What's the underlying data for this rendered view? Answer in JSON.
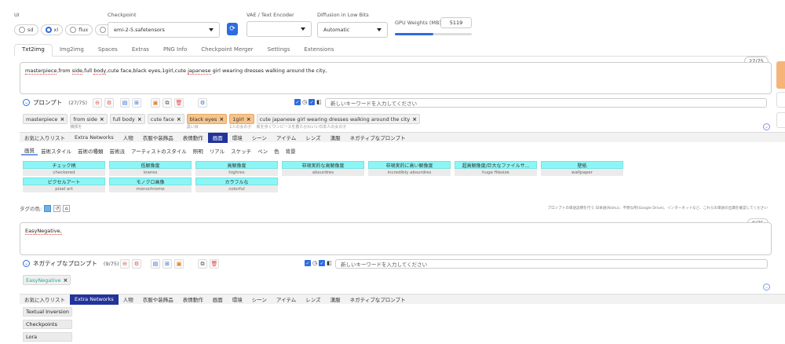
{
  "top": {
    "ui_label": "UI",
    "ui_options": [
      "sd",
      "xl",
      "flux",
      "all"
    ],
    "checkpoint_label": "Checkpoint",
    "checkpoint_value": "emi-2-5.safetensors",
    "vae_label": "VAE / Text Encoder",
    "vae_value": "",
    "diffusion_label": "Diffusion in Low Bits",
    "diffusion_value": "Automatic",
    "gpu_label": "GPU Weights (MB)",
    "gpu_value": "5119",
    "gpu_fraction": 0.5
  },
  "tabs": [
    "Txt2img",
    "Img2img",
    "Spaces",
    "Extras",
    "PNG Info",
    "Checkpoint Merger",
    "Settings",
    "Extensions"
  ],
  "prompt": {
    "counter": "27/75",
    "text_parts": [
      {
        "t": "masterpiece",
        "u": true
      },
      {
        "t": ",from ",
        "u": false
      },
      {
        "t": "side",
        "u": true
      },
      {
        "t": ",full ",
        "u": false
      },
      {
        "t": "body",
        "u": true
      },
      {
        "t": ",cute face,black eyes,1girl,cute ",
        "u": false
      },
      {
        "t": "japanese",
        "u": true
      },
      {
        "t": " girl wearing dresses walking around the city,",
        "u": false
      }
    ],
    "label": "プロンプト",
    "label_count": "(27/75)",
    "keyword_placeholder": "新しいキーワードを入力してください"
  },
  "prompt_tags": [
    {
      "text": "masterpiece",
      "sub": "",
      "style": "gray"
    },
    {
      "text": "from side",
      "sub": "横顔を",
      "style": "gray"
    },
    {
      "text": "full body",
      "sub": "",
      "style": "gray"
    },
    {
      "text": "cute face",
      "sub": "",
      "style": "gray"
    },
    {
      "text": "black eyes",
      "sub": "黒い目",
      "style": "orange"
    },
    {
      "text": "1girl",
      "sub": "1人の女の子",
      "style": "orange"
    },
    {
      "text": "cute japanese girl wearing dresses walking around the city",
      "sub": "街を歩くワンピースを着たかわいい日本人の女の子",
      "style": "gray"
    }
  ],
  "categories": [
    "お気に入りリスト",
    "Extra Networks",
    "人物",
    "衣服や装飾品",
    "表情動作",
    "画面",
    "環境",
    "シーン",
    "アイテム",
    "レンズ",
    "漢服",
    "ネガティブなプロンプト"
  ],
  "active_category": "画面",
  "subcategories": [
    "画質",
    "芸術スタイル",
    "芸術の種類",
    "芸術派",
    "アーティストのスタイル",
    "照明",
    "リアル",
    "スケッチ",
    "ペン",
    "色",
    "背景"
  ],
  "keywords": [
    {
      "jp": "チェック柄",
      "en": "checkered"
    },
    {
      "jp": "低解像度",
      "en": "lowres"
    },
    {
      "jp": "高解像度",
      "en": "highres"
    },
    {
      "jp": "非現実的な高解像度",
      "en": "absurdres"
    },
    {
      "jp": "非現実的に高い解像度",
      "en": "incredibly absurdres"
    },
    {
      "jp": "超高解像度/巨大なファイルサ...",
      "en": "huge filesize"
    },
    {
      "jp": "壁紙",
      "en": "wallpaper"
    },
    {
      "jp": "ピクセルアート",
      "en": "pixel art"
    },
    {
      "jp": "モノクロ画像",
      "en": "monochrome"
    },
    {
      "jp": "カラフルな",
      "en": "colorful"
    }
  ],
  "tag_color_label": "タグの色:",
  "footnote": "プロンプトの単語説明を行う 日本語(Nishu)、不明な所(Google Drive)、インターネットなど、これらの単語の出典を確認してください",
  "negative": {
    "counter": "9/75",
    "text": "EasyNegative,",
    "label": "ネガティブなプロンプト",
    "label_count": "(9/75)",
    "keyword_placeholder": "新しいキーワードを入力してください",
    "tag": "EasyNegative"
  },
  "negative_categories": [
    "お気に入りリスト",
    "Extra Networks",
    "人物",
    "衣服や装飾品",
    "表情動作",
    "画面",
    "環境",
    "シーン",
    "アイテム",
    "レンズ",
    "漢服",
    "ネガティブなプロンプト"
  ],
  "negative_active_category": "Extra Networks",
  "network_list": [
    "Textual Inversion",
    "Checkpoints",
    "Lora"
  ],
  "colors": {
    "accent": "#2d6cdf",
    "category_active": "#22339b",
    "keyword_bg": "#8cf6f6",
    "orange_tag": "#f6c48c"
  }
}
